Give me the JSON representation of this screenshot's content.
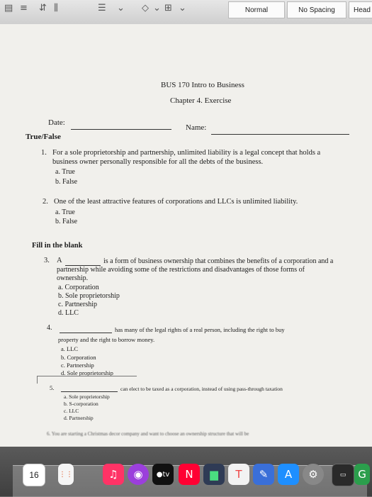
{
  "ribbon": {
    "styles": [
      "Normal",
      "No Spacing",
      "Head"
    ]
  },
  "document": {
    "course": "BUS 170 Intro to Business",
    "chapter": "Chapter 4. Exercise",
    "date_label": "Date:",
    "name_label": "Name:",
    "section_tf": "True/False",
    "q1": {
      "num": "1.",
      "line1": "For a sole proprietorship and partnership, unlimited liability is a legal concept that holds a",
      "line2": "business owner personally responsible for all the debts of the business.",
      "options": [
        "a.  True",
        "b.  False"
      ]
    },
    "q2": {
      "num": "2.",
      "text": "One of the least attractive features of corporations and LLCs is unlimited liability.",
      "options": [
        "a.  True",
        "b.  False"
      ]
    },
    "section_fill": "Fill in the blank",
    "q3": {
      "num": "3.",
      "lead": "A",
      "line1": "is a form of business ownership that combines the benefits of a corporation and a",
      "line2": "partnership while avoiding some of the restrictions and disadvantages of those forms of",
      "line3": "ownership.",
      "options": [
        "a.  Corporation",
        "b.  Sole proprietorship",
        "c.  Partnership",
        "d.  LLC"
      ]
    },
    "q4": {
      "num": "4.",
      "line1": "has many of the legal rights of a real person, including the right to buy",
      "line2": "property and the right to borrow money.",
      "options": [
        "a.  LLC",
        "b.  Corporation",
        "c.  Partnership",
        "d.  Sole proprietorship"
      ]
    },
    "q5": {
      "num": "5.",
      "line1": "can elect to be taxed as a corporation, instead of using pass-through taxation",
      "options": [
        "a.  Sole proprietorship",
        "b.  S-corporation",
        "c.  LLC",
        "d.  Partnership"
      ]
    },
    "q6": {
      "text": "6.   You are starting a Christmas decor company and want to choose an ownership structure that will be"
    }
  },
  "dock": {
    "calendar_day": "16",
    "tv_label": "tv"
  }
}
